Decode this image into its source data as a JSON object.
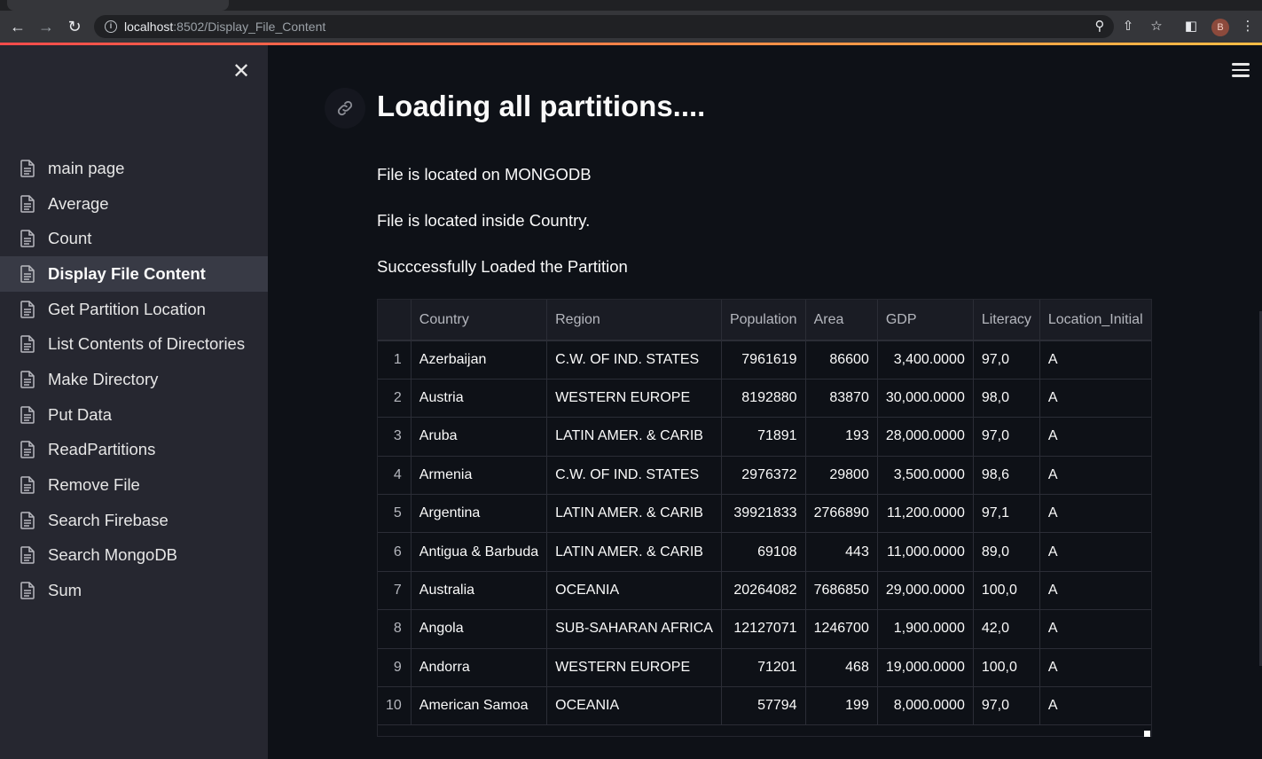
{
  "browser": {
    "url_host": "localhost",
    "url_path": ":8502/Display_File_Content",
    "profile_initial": "B"
  },
  "sidebar": {
    "items": [
      {
        "label": "main page",
        "active": false
      },
      {
        "label": "Average",
        "active": false
      },
      {
        "label": "Count",
        "active": false
      },
      {
        "label": "Display File Content",
        "active": true
      },
      {
        "label": "Get Partition Location",
        "active": false
      },
      {
        "label": "List Contents of Directories",
        "active": false
      },
      {
        "label": "Make Directory",
        "active": false
      },
      {
        "label": "Put Data",
        "active": false
      },
      {
        "label": "ReadPartitions",
        "active": false
      },
      {
        "label": "Remove File",
        "active": false
      },
      {
        "label": "Search Firebase",
        "active": false
      },
      {
        "label": "Search MongoDB",
        "active": false
      },
      {
        "label": "Sum",
        "active": false
      }
    ]
  },
  "main": {
    "title": "Loading all partitions....",
    "lines": [
      "File is located on MONGODB",
      "File is located inside Country.",
      "Succcessfully Loaded the Partition"
    ]
  },
  "table": {
    "columns": [
      "",
      "Country",
      "Region",
      "Population",
      "Area",
      "GDP",
      "Literacy",
      "Location_Initial"
    ],
    "rows": [
      [
        "1",
        "Azerbaijan",
        "C.W. OF IND. STATES",
        "7961619",
        "86600",
        "3,400.0000",
        "97,0",
        "A"
      ],
      [
        "2",
        "Austria",
        "WESTERN EUROPE",
        "8192880",
        "83870",
        "30,000.0000",
        "98,0",
        "A"
      ],
      [
        "3",
        "Aruba",
        "LATIN AMER. & CARIB",
        "71891",
        "193",
        "28,000.0000",
        "97,0",
        "A"
      ],
      [
        "4",
        "Armenia",
        "C.W. OF IND. STATES",
        "2976372",
        "29800",
        "3,500.0000",
        "98,6",
        "A"
      ],
      [
        "5",
        "Argentina",
        "LATIN AMER. & CARIB",
        "39921833",
        "2766890",
        "11,200.0000",
        "97,1",
        "A"
      ],
      [
        "6",
        "Antigua & Barbuda",
        "LATIN AMER. & CARIB",
        "69108",
        "443",
        "11,000.0000",
        "89,0",
        "A"
      ],
      [
        "7",
        "Australia",
        "OCEANIA",
        "20264082",
        "7686850",
        "29,000.0000",
        "100,0",
        "A"
      ],
      [
        "8",
        "Angola",
        "SUB-SAHARAN AFRICA",
        "12127071",
        "1246700",
        "1,900.0000",
        "42,0",
        "A"
      ],
      [
        "9",
        "Andorra",
        "WESTERN EUROPE",
        "71201",
        "468",
        "19,000.0000",
        "100,0",
        "A"
      ],
      [
        "10",
        "American Samoa",
        "OCEANIA",
        "57794",
        "199",
        "8,000.0000",
        "97,0",
        "A"
      ]
    ]
  }
}
